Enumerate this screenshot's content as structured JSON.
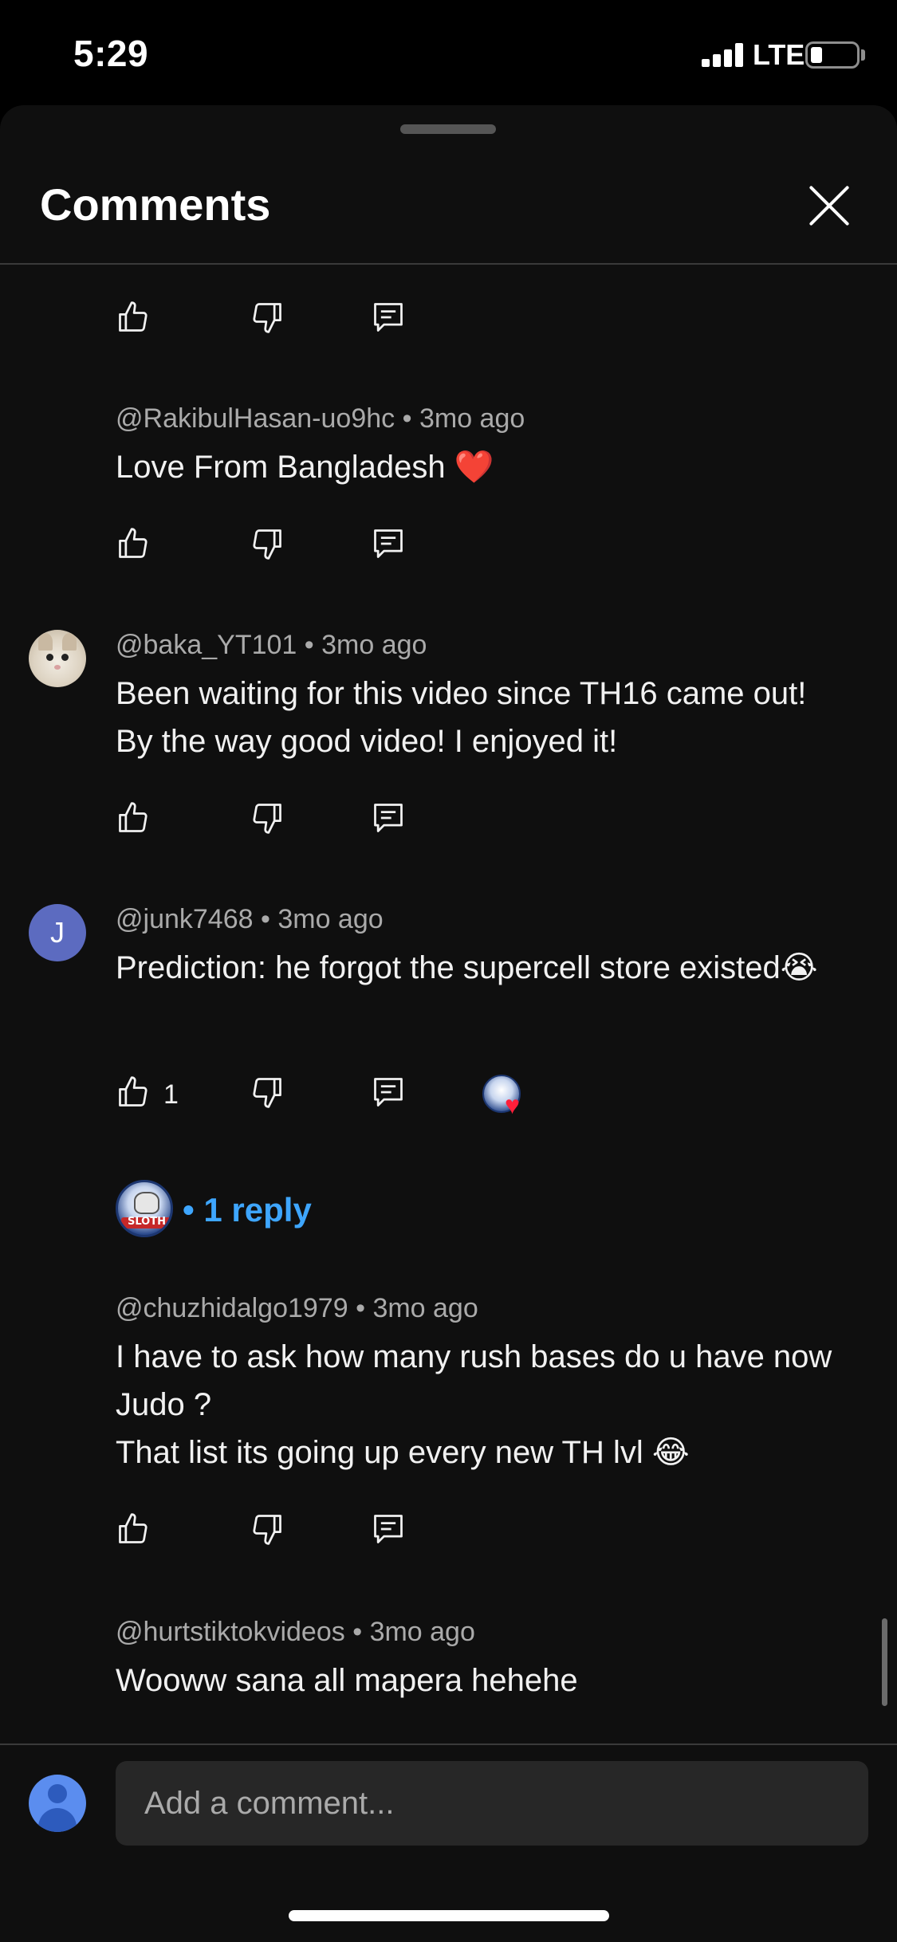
{
  "status_bar": {
    "time": "5:29",
    "network": "LTE",
    "battery_level": 0.2
  },
  "sheet": {
    "title": "Comments"
  },
  "comments": [
    {
      "author": "",
      "age": "",
      "text": "",
      "likes": ""
    },
    {
      "author": "@RakibulHasan-uo9hc",
      "age": "3mo ago",
      "text": "Love From Bangladesh",
      "emoji": "❤️",
      "likes": ""
    },
    {
      "author": "@baka_YT101",
      "age": "3mo ago",
      "text": "Been waiting for this video since TH16 came out! By the way good video! I enjoyed it!",
      "likes": ""
    },
    {
      "author": "@junk7468",
      "avatar_letter": "J",
      "age": "3mo ago",
      "text": "Prediction: he forgot the supercell store existed",
      "emoji": "😭",
      "likes": "1",
      "replies_label": "1 reply",
      "creator_badge_text": "SLOTH"
    },
    {
      "author": "@chuzhidalgo1979",
      "age": "3mo ago",
      "text_line1": "I have to ask how many rush bases do u have now Judo ?",
      "text_line2": "That list its going up every new TH lvl",
      "emoji": "😂",
      "likes": ""
    },
    {
      "author": "@hurtstiktokvideos",
      "age": "3mo ago",
      "text": "Wooww sana all mapera hehehe"
    }
  ],
  "separator": "•",
  "composer": {
    "placeholder": "Add a comment..."
  },
  "icons": [
    "thumb-up-icon",
    "thumb-down-icon",
    "reply-icon",
    "close-icon"
  ],
  "colors": {
    "background": "#0f0f0f",
    "link_blue": "#3ea6ff",
    "meta_gray": "#aaaaaa",
    "input_bg": "#272727"
  }
}
